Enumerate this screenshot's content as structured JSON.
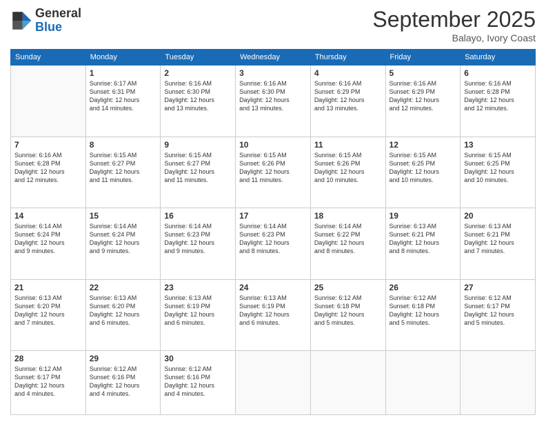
{
  "logo": {
    "line1": "General",
    "line2": "Blue"
  },
  "title": "September 2025",
  "location": "Balayo, Ivory Coast",
  "days_of_week": [
    "Sunday",
    "Monday",
    "Tuesday",
    "Wednesday",
    "Thursday",
    "Friday",
    "Saturday"
  ],
  "weeks": [
    [
      {
        "day": "",
        "info": ""
      },
      {
        "day": "1",
        "info": "Sunrise: 6:17 AM\nSunset: 6:31 PM\nDaylight: 12 hours\nand 14 minutes."
      },
      {
        "day": "2",
        "info": "Sunrise: 6:16 AM\nSunset: 6:30 PM\nDaylight: 12 hours\nand 13 minutes."
      },
      {
        "day": "3",
        "info": "Sunrise: 6:16 AM\nSunset: 6:30 PM\nDaylight: 12 hours\nand 13 minutes."
      },
      {
        "day": "4",
        "info": "Sunrise: 6:16 AM\nSunset: 6:29 PM\nDaylight: 12 hours\nand 13 minutes."
      },
      {
        "day": "5",
        "info": "Sunrise: 6:16 AM\nSunset: 6:29 PM\nDaylight: 12 hours\nand 12 minutes."
      },
      {
        "day": "6",
        "info": "Sunrise: 6:16 AM\nSunset: 6:28 PM\nDaylight: 12 hours\nand 12 minutes."
      }
    ],
    [
      {
        "day": "7",
        "info": "Sunrise: 6:16 AM\nSunset: 6:28 PM\nDaylight: 12 hours\nand 12 minutes."
      },
      {
        "day": "8",
        "info": "Sunrise: 6:15 AM\nSunset: 6:27 PM\nDaylight: 12 hours\nand 11 minutes."
      },
      {
        "day": "9",
        "info": "Sunrise: 6:15 AM\nSunset: 6:27 PM\nDaylight: 12 hours\nand 11 minutes."
      },
      {
        "day": "10",
        "info": "Sunrise: 6:15 AM\nSunset: 6:26 PM\nDaylight: 12 hours\nand 11 minutes."
      },
      {
        "day": "11",
        "info": "Sunrise: 6:15 AM\nSunset: 6:26 PM\nDaylight: 12 hours\nand 10 minutes."
      },
      {
        "day": "12",
        "info": "Sunrise: 6:15 AM\nSunset: 6:25 PM\nDaylight: 12 hours\nand 10 minutes."
      },
      {
        "day": "13",
        "info": "Sunrise: 6:15 AM\nSunset: 6:25 PM\nDaylight: 12 hours\nand 10 minutes."
      }
    ],
    [
      {
        "day": "14",
        "info": "Sunrise: 6:14 AM\nSunset: 6:24 PM\nDaylight: 12 hours\nand 9 minutes."
      },
      {
        "day": "15",
        "info": "Sunrise: 6:14 AM\nSunset: 6:24 PM\nDaylight: 12 hours\nand 9 minutes."
      },
      {
        "day": "16",
        "info": "Sunrise: 6:14 AM\nSunset: 6:23 PM\nDaylight: 12 hours\nand 9 minutes."
      },
      {
        "day": "17",
        "info": "Sunrise: 6:14 AM\nSunset: 6:23 PM\nDaylight: 12 hours\nand 8 minutes."
      },
      {
        "day": "18",
        "info": "Sunrise: 6:14 AM\nSunset: 6:22 PM\nDaylight: 12 hours\nand 8 minutes."
      },
      {
        "day": "19",
        "info": "Sunrise: 6:13 AM\nSunset: 6:21 PM\nDaylight: 12 hours\nand 8 minutes."
      },
      {
        "day": "20",
        "info": "Sunrise: 6:13 AM\nSunset: 6:21 PM\nDaylight: 12 hours\nand 7 minutes."
      }
    ],
    [
      {
        "day": "21",
        "info": "Sunrise: 6:13 AM\nSunset: 6:20 PM\nDaylight: 12 hours\nand 7 minutes."
      },
      {
        "day": "22",
        "info": "Sunrise: 6:13 AM\nSunset: 6:20 PM\nDaylight: 12 hours\nand 6 minutes."
      },
      {
        "day": "23",
        "info": "Sunrise: 6:13 AM\nSunset: 6:19 PM\nDaylight: 12 hours\nand 6 minutes."
      },
      {
        "day": "24",
        "info": "Sunrise: 6:13 AM\nSunset: 6:19 PM\nDaylight: 12 hours\nand 6 minutes."
      },
      {
        "day": "25",
        "info": "Sunrise: 6:12 AM\nSunset: 6:18 PM\nDaylight: 12 hours\nand 5 minutes."
      },
      {
        "day": "26",
        "info": "Sunrise: 6:12 AM\nSunset: 6:18 PM\nDaylight: 12 hours\nand 5 minutes."
      },
      {
        "day": "27",
        "info": "Sunrise: 6:12 AM\nSunset: 6:17 PM\nDaylight: 12 hours\nand 5 minutes."
      }
    ],
    [
      {
        "day": "28",
        "info": "Sunrise: 6:12 AM\nSunset: 6:17 PM\nDaylight: 12 hours\nand 4 minutes."
      },
      {
        "day": "29",
        "info": "Sunrise: 6:12 AM\nSunset: 6:16 PM\nDaylight: 12 hours\nand 4 minutes."
      },
      {
        "day": "30",
        "info": "Sunrise: 6:12 AM\nSunset: 6:16 PM\nDaylight: 12 hours\nand 4 minutes."
      },
      {
        "day": "",
        "info": ""
      },
      {
        "day": "",
        "info": ""
      },
      {
        "day": "",
        "info": ""
      },
      {
        "day": "",
        "info": ""
      }
    ]
  ]
}
